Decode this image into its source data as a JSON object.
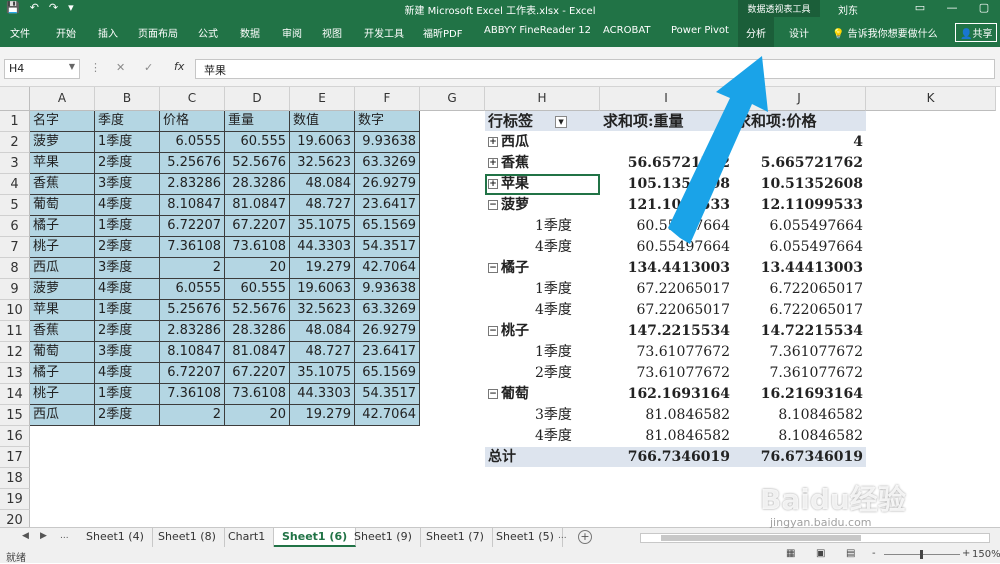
{
  "titlebar": {
    "qat": [
      "💾",
      "↶",
      "↷",
      "▾"
    ],
    "title": "新建 Microsoft Excel 工作表.xlsx  -  Excel",
    "context_tools": "数据透视表工具",
    "user": "刘东",
    "window_controls": [
      "▭",
      "—",
      "▢"
    ]
  },
  "ribbon": {
    "tabs": [
      "文件",
      "开始",
      "插入",
      "页面布局",
      "公式",
      "数据",
      "审阅",
      "视图",
      "开发工具",
      "福昕PDF",
      "ABBYY FineReader 12",
      "ACROBAT",
      "Power Pivot",
      "分析",
      "设计"
    ],
    "active_tab": "分析",
    "tell_me": "告诉我你想要做什么",
    "share": "共享"
  },
  "formula_bar": {
    "name_box": "H4",
    "formula": "苹果",
    "cancel": "✕",
    "enter": "✓",
    "fx": "fx"
  },
  "columns": [
    "A",
    "B",
    "C",
    "D",
    "E",
    "F",
    "G",
    "H",
    "I",
    "J",
    "K"
  ],
  "rows": [
    "1",
    "2",
    "3",
    "4",
    "5",
    "6",
    "7",
    "8",
    "9",
    "10",
    "11",
    "12",
    "13",
    "14",
    "15",
    "16",
    "17",
    "18",
    "19",
    "20"
  ],
  "source_table": {
    "headers": [
      "名字",
      "季度",
      "价格",
      "重量",
      "数值",
      "数字"
    ],
    "rows": [
      [
        "菠萝",
        "1季度",
        "6.0555",
        "60.555",
        "19.6063",
        "9.93638"
      ],
      [
        "苹果",
        "2季度",
        "5.25676",
        "52.5676",
        "32.5623",
        "63.3269"
      ],
      [
        "香蕉",
        "3季度",
        "2.83286",
        "28.3286",
        "48.084",
        "26.9279"
      ],
      [
        "葡萄",
        "4季度",
        "8.10847",
        "81.0847",
        "48.727",
        "23.6417"
      ],
      [
        "橘子",
        "1季度",
        "6.72207",
        "67.2207",
        "35.1075",
        "65.1569"
      ],
      [
        "桃子",
        "2季度",
        "7.36108",
        "73.6108",
        "44.3303",
        "54.3517"
      ],
      [
        "西瓜",
        "3季度",
        "2",
        "20",
        "19.279",
        "42.7064"
      ],
      [
        "菠萝",
        "4季度",
        "6.0555",
        "60.555",
        "19.6063",
        "9.93638"
      ],
      [
        "苹果",
        "1季度",
        "5.25676",
        "52.5676",
        "32.5623",
        "63.3269"
      ],
      [
        "香蕉",
        "2季度",
        "2.83286",
        "28.3286",
        "48.084",
        "26.9279"
      ],
      [
        "葡萄",
        "3季度",
        "8.10847",
        "81.0847",
        "48.727",
        "23.6417"
      ],
      [
        "橘子",
        "4季度",
        "6.72207",
        "67.2207",
        "35.1075",
        "65.1569"
      ],
      [
        "桃子",
        "1季度",
        "7.36108",
        "73.6108",
        "44.3303",
        "54.3517"
      ],
      [
        "西瓜",
        "2季度",
        "2",
        "20",
        "19.279",
        "42.7064"
      ]
    ]
  },
  "pivot": {
    "headers": [
      "行标签",
      "求和项:重量",
      "求和项:价格"
    ],
    "rows": [
      {
        "label": "西瓜",
        "kind": "collapsed",
        "weight": "40",
        "price": "4"
      },
      {
        "label": "香蕉",
        "kind": "collapsed",
        "weight": "56.65721762",
        "price": "5.665721762"
      },
      {
        "label": "苹果",
        "kind": "collapsed",
        "weight": "105.1352608",
        "price": "10.51352608"
      },
      {
        "label": "菠萝",
        "kind": "expanded",
        "weight": "121.1099533",
        "price": "12.11099533"
      },
      {
        "label": "1季度",
        "kind": "child",
        "weight": "60.55497664",
        "price": "6.055497664"
      },
      {
        "label": "4季度",
        "kind": "child",
        "weight": "60.55497664",
        "price": "6.055497664"
      },
      {
        "label": "橘子",
        "kind": "expanded",
        "weight": "134.4413003",
        "price": "13.44413003"
      },
      {
        "label": "1季度",
        "kind": "child",
        "weight": "67.22065017",
        "price": "6.722065017"
      },
      {
        "label": "4季度",
        "kind": "child",
        "weight": "67.22065017",
        "price": "6.722065017"
      },
      {
        "label": "桃子",
        "kind": "expanded",
        "weight": "147.2215534",
        "price": "14.72215534"
      },
      {
        "label": "1季度",
        "kind": "child",
        "weight": "73.61077672",
        "price": "7.361077672"
      },
      {
        "label": "2季度",
        "kind": "child",
        "weight": "73.61077672",
        "price": "7.361077672"
      },
      {
        "label": "葡萄",
        "kind": "expanded",
        "weight": "162.1693164",
        "price": "16.21693164"
      },
      {
        "label": "3季度",
        "kind": "child",
        "weight": "81.0846582",
        "price": "8.10846582"
      },
      {
        "label": "4季度",
        "kind": "child",
        "weight": "81.0846582",
        "price": "8.10846582"
      }
    ],
    "total": {
      "label": "总计",
      "weight": "766.7346019",
      "price": "76.67346019"
    }
  },
  "sheets": {
    "tabs": [
      "Sheet1 (4)",
      "Sheet1 (8)",
      "Chart1",
      "Sheet1 (6)",
      "Sheet1 (9)",
      "Sheet1 (7)",
      "Sheet1 (5)"
    ],
    "active": "Sheet1 (6)",
    "more": "...",
    "add": "+"
  },
  "status": {
    "ready": "就绪",
    "zoom": "150%",
    "zoom_minus": "-",
    "zoom_plus": "+"
  },
  "watermark": {
    "logo": "Baidu经验",
    "url": "jingyan.baidu.com"
  },
  "colors": {
    "excel_green": "#217346",
    "table_fill": "#b4d6e3",
    "pivot_header": "#dde4ee",
    "arrow": "#1aa3e8"
  }
}
